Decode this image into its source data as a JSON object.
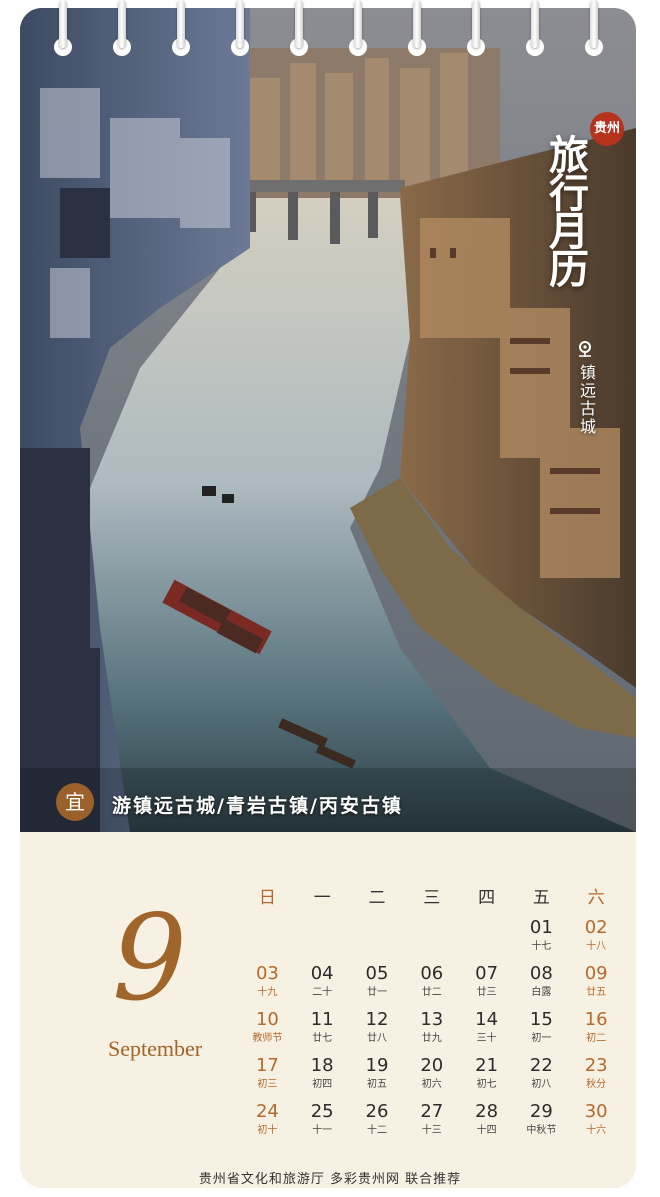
{
  "photo": {
    "badge": "贵州",
    "title": "旅行月历",
    "place_icon": "location-pin-icon",
    "place": "镇远古城",
    "yi_label": "宜",
    "activities": "游镇远古城/青岩古镇/丙安古镇"
  },
  "month": {
    "number": "9",
    "name": "September"
  },
  "calendar": {
    "weekdays": [
      "日",
      "一",
      "二",
      "三",
      "四",
      "五",
      "六"
    ],
    "weeks": [
      [
        {
          "d": "",
          "l": ""
        },
        {
          "d": "",
          "l": ""
        },
        {
          "d": "",
          "l": ""
        },
        {
          "d": "",
          "l": ""
        },
        {
          "d": "",
          "l": ""
        },
        {
          "d": "01",
          "l": "十七"
        },
        {
          "d": "02",
          "l": "十八"
        }
      ],
      [
        {
          "d": "03",
          "l": "十九"
        },
        {
          "d": "04",
          "l": "二十"
        },
        {
          "d": "05",
          "l": "廿一"
        },
        {
          "d": "06",
          "l": "廿二"
        },
        {
          "d": "07",
          "l": "廿三"
        },
        {
          "d": "08",
          "l": "白露"
        },
        {
          "d": "09",
          "l": "廿五"
        }
      ],
      [
        {
          "d": "10",
          "l": "教师节"
        },
        {
          "d": "11",
          "l": "廿七"
        },
        {
          "d": "12",
          "l": "廿八"
        },
        {
          "d": "13",
          "l": "廿九"
        },
        {
          "d": "14",
          "l": "三十"
        },
        {
          "d": "15",
          "l": "初一"
        },
        {
          "d": "16",
          "l": "初二"
        }
      ],
      [
        {
          "d": "17",
          "l": "初三"
        },
        {
          "d": "18",
          "l": "初四"
        },
        {
          "d": "19",
          "l": "初五"
        },
        {
          "d": "20",
          "l": "初六"
        },
        {
          "d": "21",
          "l": "初七"
        },
        {
          "d": "22",
          "l": "初八"
        },
        {
          "d": "23",
          "l": "秋分"
        }
      ],
      [
        {
          "d": "24",
          "l": "初十"
        },
        {
          "d": "25",
          "l": "十一"
        },
        {
          "d": "26",
          "l": "十二"
        },
        {
          "d": "27",
          "l": "十三"
        },
        {
          "d": "28",
          "l": "十四"
        },
        {
          "d": "29",
          "l": "中秋节"
        },
        {
          "d": "30",
          "l": "十六"
        }
      ]
    ]
  },
  "footer": "贵州省文化和旅游厅  多彩贵州网  联合推荐",
  "colors": {
    "accent": "#a0652a",
    "badge": "#b7321c",
    "paper": "#f6f1e2"
  }
}
